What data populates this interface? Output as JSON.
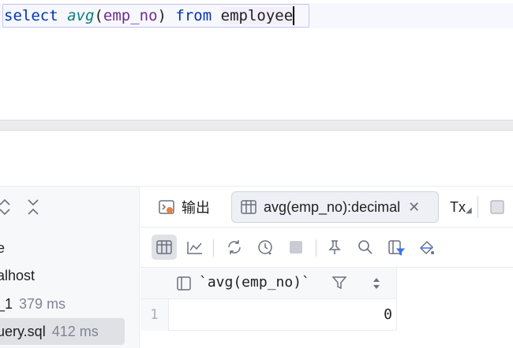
{
  "editor": {
    "tokens": {
      "kw_select": "select",
      "fn_avg": "avg",
      "open_paren": "(",
      "column": "emp_no",
      "close_paren": ")",
      "kw_from": "from",
      "table": "employee"
    }
  },
  "services": {
    "items": [
      {
        "label": "e",
        "time": ""
      },
      {
        "label": "alhost",
        "time": ""
      },
      {
        "label": "_1",
        "time": "379 ms"
      },
      {
        "label": "uery.sql",
        "time": "412 ms"
      }
    ]
  },
  "results": {
    "tabs": {
      "output": "输出",
      "result": "avg(emp_no):decimal",
      "tx": "Tx"
    },
    "grid": {
      "columns": [
        "`avg(emp_no)`"
      ],
      "rows": [
        {
          "num": "1",
          "cells": [
            "0"
          ]
        }
      ]
    }
  },
  "icons": {
    "expand": "chevron-up-down-icon",
    "collapse": "collapse-icon",
    "output": "console-output-icon",
    "result_tab": "table-icon",
    "close": "close-icon",
    "table_view": "table-view-icon",
    "chart": "chart-icon",
    "refresh": "refresh-icon",
    "history": "clock-icon",
    "stop": "stop-icon",
    "pin": "pin-icon",
    "search": "search-icon",
    "filter_cols": "filter-columns-icon",
    "clear": "clear-icon"
  },
  "colors": {
    "keyword": "#0033b3",
    "function": "#0a7b7b",
    "identifier": "#6f2e8a",
    "selection_border": "#c9c4f2"
  }
}
